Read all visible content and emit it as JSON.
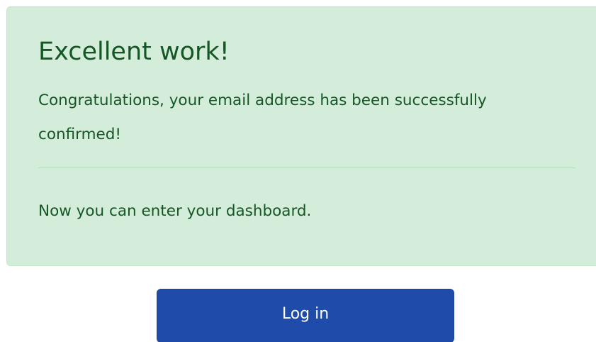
{
  "alert": {
    "heading": "Excellent work!",
    "message": "Congratulations, your email address has been successfully confirmed!",
    "footer": "Now you can enter your dashboard."
  },
  "actions": {
    "login_label": "Log in"
  },
  "colors": {
    "alert_background": "#d4edda",
    "alert_text": "#155724",
    "button_background": "#1f4baa",
    "button_text": "#ffffff"
  }
}
